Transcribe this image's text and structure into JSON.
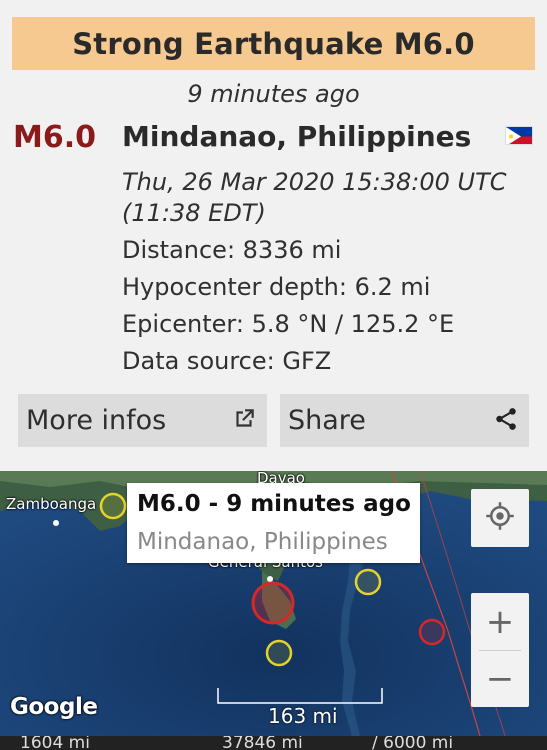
{
  "banner": {
    "title": "Strong Earthquake M6.0"
  },
  "time_ago": "9 minutes ago",
  "quake": {
    "magnitude": "M6.0",
    "place": "Mindanao, Philippines",
    "flag": "philippines-flag",
    "datetime_line1": "Thu, 26 Mar 2020 15:38:00 UTC",
    "datetime_line2": "(11:38 EDT)",
    "distance": "Distance: 8336 mi",
    "depth": "Hypocenter depth: 6.2 mi",
    "epicenter": "Epicenter: 5.8 °N / 125.2 °E",
    "source": "Data source: GFZ"
  },
  "actions": {
    "more_label": "More infos",
    "more_icon": "open-external-icon",
    "share_label": "Share",
    "share_icon": "share-icon"
  },
  "map": {
    "popup_title": "M6.0  -  9 minutes ago",
    "popup_subtitle": "Mindanao, Philippines",
    "cities": {
      "zamboanga": "Zamboanga",
      "davao": "Davao",
      "gensan": "General Santos"
    },
    "scale_label": "163 mi",
    "attribution": "Google",
    "zoom_in": "+",
    "zoom_out": "−",
    "colors": {
      "quake_red": "#d62828",
      "quake_yellow": "#e3d32a",
      "ocean": "#1c3f6e",
      "land": "#4a6a4a"
    }
  },
  "bottom_strip": {
    "left": "1604 mi",
    "mid": "37846 mi",
    "right": "/ 6000 mi"
  }
}
